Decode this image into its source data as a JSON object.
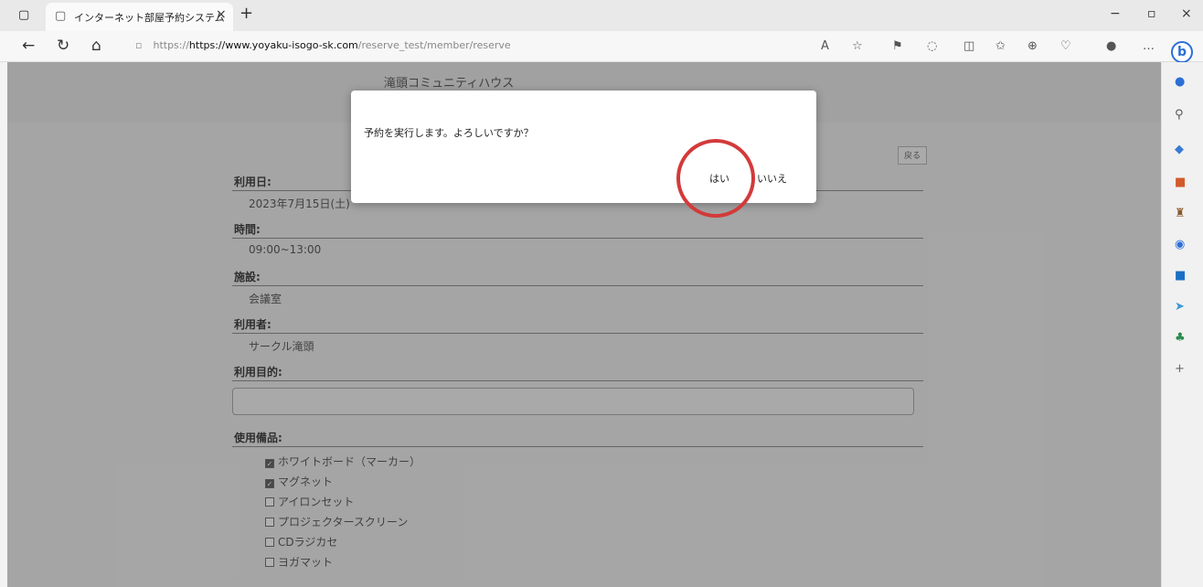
{
  "browser": {
    "tab_title": "インターネット部屋予約システム",
    "url_host": "https://www.yoyaku-isogo-sk.com",
    "url_path": "/reserve_test/member/reserve"
  },
  "site": {
    "title": "滝頭コミュニティハウス",
    "back_label": "戻る"
  },
  "form": {
    "date_label": "利用日:",
    "date_value": "2023年7月15日(土)",
    "time_label": "時間:",
    "time_value": "09:00~13:00",
    "facility_label": "施設:",
    "facility_value": "会議室",
    "user_label": "利用者:",
    "user_value": "サークル滝頭",
    "purpose_label": "利用目的:",
    "equipment_label": "使用備品:",
    "equipment": [
      {
        "label": "ホワイトボード（マーカー）",
        "checked": true
      },
      {
        "label": "マグネット",
        "checked": true
      },
      {
        "label": "アイロンセット",
        "checked": false
      },
      {
        "label": "プロジェクタースクリーン",
        "checked": false
      },
      {
        "label": "CDラジカセ",
        "checked": false
      },
      {
        "label": "ヨガマット",
        "checked": false
      }
    ]
  },
  "dialog": {
    "message": "予約を実行します。よろしいですか？",
    "yes_label": "はい",
    "no_label": "いいえ"
  },
  "annotation_color": "#d33a3a"
}
